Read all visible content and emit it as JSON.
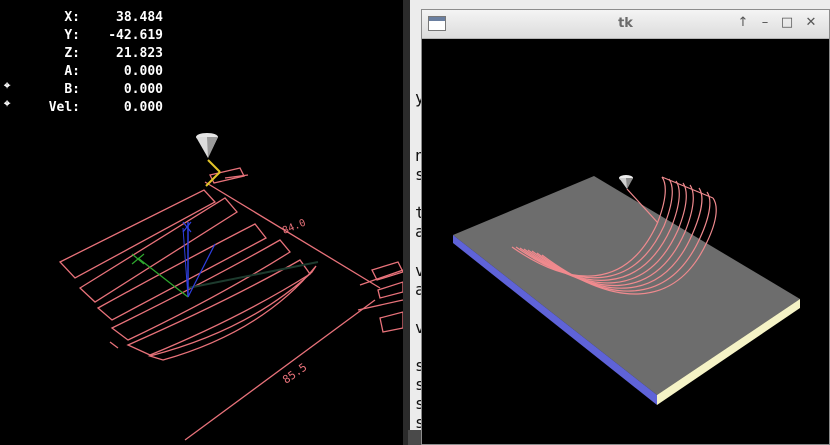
{
  "dro": {
    "rows": [
      {
        "label": "X:",
        "value": "38.484"
      },
      {
        "label": "Y:",
        "value": "-42.619"
      },
      {
        "label": "Z:",
        "value": "21.823"
      },
      {
        "label": "A:",
        "value": "0.000"
      },
      {
        "label": "B:",
        "value": "0.000"
      },
      {
        "label": "Vel:",
        "value": "0.000"
      }
    ],
    "marker_glyph": "⌖"
  },
  "dimensions": {
    "top": "84.0",
    "bottom": "85.5"
  },
  "terminal": {
    "lines": [
      "y",
      "n",
      "s",
      "t",
      "a",
      "v",
      "a",
      "v",
      "s",
      "s",
      "s",
      "s"
    ]
  },
  "tk_window": {
    "title": "tk",
    "controls": [
      "↑",
      "–",
      "□",
      "✕"
    ]
  },
  "colors": {
    "toolpath": "#e8727a",
    "plate_top": "#6d6d6d",
    "plate_front": "#f5f3c6",
    "plate_side": "#5f63d8"
  }
}
